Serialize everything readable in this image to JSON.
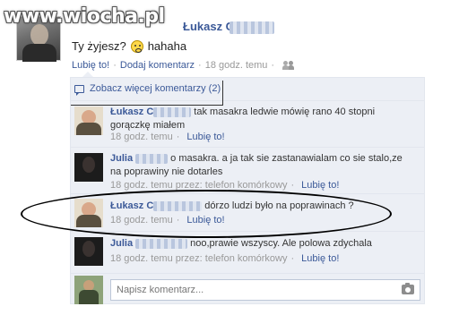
{
  "watermark": "www.wiocha.pl",
  "post": {
    "author": "Łukasz C",
    "text": "Ty żyjesz?",
    "text_after_emoji": "hahaha",
    "actions": {
      "like": "Lubię to!",
      "comment": "Dodaj komentarz",
      "time": "18 godz. temu"
    }
  },
  "comments": {
    "see_more": "Zobacz więcej komentarzy (2)",
    "items": [
      {
        "author": "Łukasz C",
        "text": "tak masakra ledwie mówię rano 40 stopni gorączkę miałem",
        "time": "18 godz. temu",
        "via": "",
        "like": "Lubię to!"
      },
      {
        "author": "Julia",
        "text": "o masakra. a ja tak sie zastanawialam co sie stalo,ze na poprawiny nie dotarles",
        "time": "18 godz. temu",
        "via": "przez: telefon komórkowy",
        "like": "Lubię to!"
      },
      {
        "author": "Łukasz C",
        "text": "dórzo ludzi było na poprawinach ?",
        "time": "18 godz. temu",
        "via": "",
        "like": "Lubię to!"
      },
      {
        "author": "Julia",
        "text": "noo,prawie wszyscy. Ale polowa zdychala",
        "time": "18 godz. temu",
        "via": "przez: telefon komórkowy",
        "like": "Lubię to!"
      }
    ],
    "input_placeholder": "Napisz komentarz..."
  },
  "icons": {
    "smiley": "smiley-emoji-icon",
    "audience": "friends-icon",
    "comments": "comment-bubble-icon",
    "attach": "camera-icon"
  },
  "colors": {
    "link": "#3b5998",
    "comment_bg": "#eceff5",
    "meta": "#999999"
  }
}
